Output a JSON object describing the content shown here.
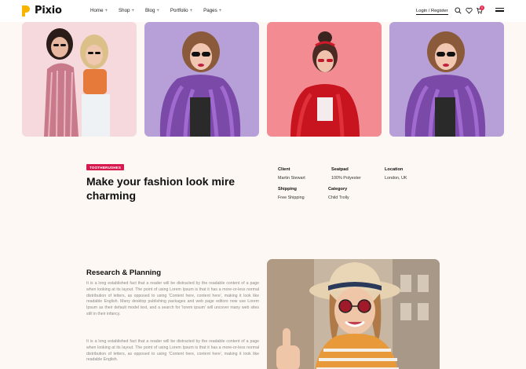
{
  "header": {
    "brand": "Pixio",
    "nav": [
      {
        "label": "Home",
        "plus": "+"
      },
      {
        "label": "Shop",
        "plus": "+"
      },
      {
        "label": "Blog",
        "plus": "+"
      },
      {
        "label": "Portfolio",
        "plus": "+"
      },
      {
        "label": "Pages",
        "plus": "+"
      }
    ],
    "login_label": "Login / Register",
    "cart_count": "0",
    "icons": [
      "search-icon",
      "heart-icon",
      "cart-icon",
      "menu-icon"
    ]
  },
  "colors": {
    "accent": "#d8194e",
    "logo": "#f7b500",
    "background": "#fdf8f3"
  },
  "project": {
    "badge": "TOOTHBRUSHES",
    "title": "Make your fashion look mire charming",
    "meta": [
      {
        "label": "Client",
        "value": "Martin Stewart"
      },
      {
        "label": "Seatpad",
        "value": "100% Polyester"
      },
      {
        "label": "Location",
        "value": "London, UK"
      },
      {
        "label": "Shipping",
        "value": "Free Shipping"
      },
      {
        "label": "Category",
        "value": "Child Trolly"
      }
    ]
  },
  "research": {
    "title": "Research & Planning",
    "paragraph1": "It is a long established fact that a reader will be distracted by the readable content of a page when looking at its layout. The point of using Lorem Ipsum is that it has a more-or-less normal distribution of letters, as opposed to using 'Content here, content here', making it look like readable English. Many desktop publishing packages and web page editors now use Lorem Ipsum as their default model text, and a search for 'lorem ipsum' will uncover many web sites still in their infancy.",
    "paragraph2": "It is a long established fact that a reader will be distracted by the readable content of a page when looking at its layout. The point of using Lorem Ipsum is that it has a more-or-less normal distribution of letters, as opposed to using 'Content here, content here', making it look like readable English."
  }
}
